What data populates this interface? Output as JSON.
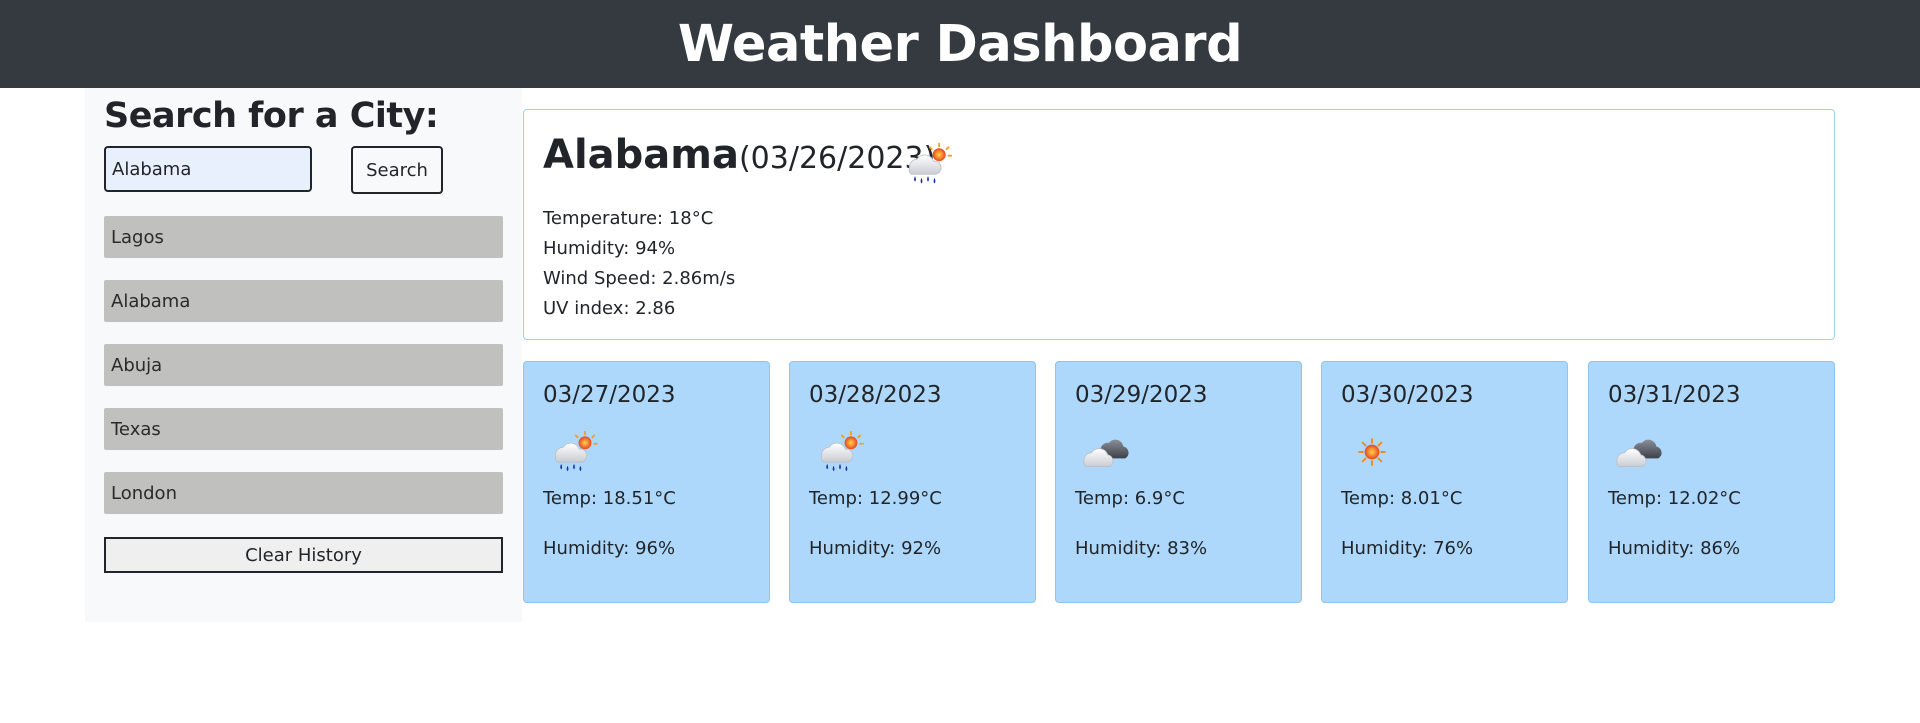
{
  "header": {
    "title": "Weather Dashboard"
  },
  "sidebar": {
    "heading": "Search for a City:",
    "search": {
      "value": "Alabama",
      "button_label": "Search"
    },
    "history": [
      "Lagos",
      "Alabama",
      "Abuja",
      "Texas",
      "London"
    ],
    "clear_label": "Clear History"
  },
  "current": {
    "city": "Alabama",
    "date": "(03/26/2023)",
    "icon": "rain-sun-icon",
    "temperature": "Temperature: 18°C",
    "humidity": "Humidity: 94%",
    "wind": "Wind Speed: 2.86m/s",
    "uv": "UV index: 2.86"
  },
  "forecast": [
    {
      "date": "03/27/2023",
      "icon": "rain-sun-icon",
      "temp": "Temp: 18.51°C",
      "humidity": "Humidity: 96%"
    },
    {
      "date": "03/28/2023",
      "icon": "rain-sun-icon",
      "temp": "Temp: 12.99°C",
      "humidity": "Humidity: 92%"
    },
    {
      "date": "03/29/2023",
      "icon": "cloud-icon",
      "temp": "Temp: 6.9°C",
      "humidity": "Humidity: 83%"
    },
    {
      "date": "03/30/2023",
      "icon": "sun-icon",
      "temp": "Temp: 8.01°C",
      "humidity": "Humidity: 76%"
    },
    {
      "date": "03/31/2023",
      "icon": "cloud-icon",
      "temp": "Temp: 12.02°C",
      "humidity": "Humidity: 86%"
    }
  ],
  "colors": {
    "header_bg": "#343a40",
    "sidebar_bg": "#f8f9fa",
    "history_item_bg": "#c0c0bf",
    "forecast_card_bg": "#add8fb",
    "current_border": "#9fd2e3"
  }
}
